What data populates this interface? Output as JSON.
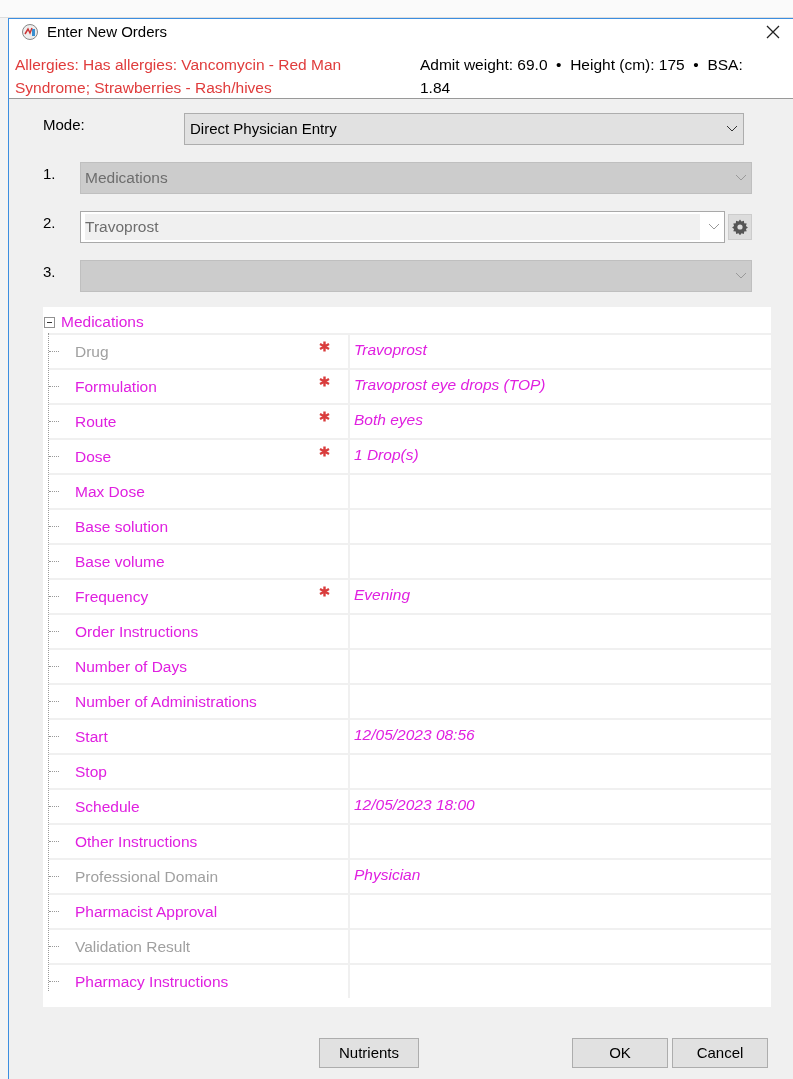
{
  "window": {
    "title": "Enter New Orders"
  },
  "allergies": "Allergies: Has allergies: Vancomycin - Red Man Syndrome; Strawberries - Rash/hives",
  "measurements": "Admit weight: 69.0  •  Height (cm): 175  •  BSA: 1.84",
  "mode": {
    "label": "Mode:",
    "value": "Direct Physician Entry"
  },
  "steps": [
    {
      "label": "1.",
      "value": "Medications",
      "disabled": true,
      "settings": false
    },
    {
      "label": "2.",
      "value": "Travoprost",
      "disabled": false,
      "settings": true
    },
    {
      "label": "3.",
      "disabled": true,
      "settings": false
    }
  ],
  "tree": {
    "title": "Medications",
    "expanded": true,
    "rows": [
      {
        "label": "Drug",
        "disabled": true,
        "required": true,
        "value": "Travoprost"
      },
      {
        "label": "Formulation",
        "disabled": false,
        "required": true,
        "value": "Travoprost eye drops (TOP)"
      },
      {
        "label": "Route",
        "disabled": false,
        "required": true,
        "value": "Both eyes"
      },
      {
        "label": "Dose",
        "disabled": false,
        "required": true,
        "value": "1 Drop(s)"
      },
      {
        "label": "Max Dose",
        "disabled": false,
        "required": false
      },
      {
        "label": "Base solution",
        "disabled": false,
        "required": false
      },
      {
        "label": "Base volume",
        "disabled": false,
        "required": false
      },
      {
        "label": "Frequency",
        "disabled": false,
        "required": true,
        "value": "Evening"
      },
      {
        "label": "Order Instructions",
        "disabled": false,
        "required": false
      },
      {
        "label": "Number of Days",
        "disabled": false,
        "required": false
      },
      {
        "label": "Number of Administrations",
        "disabled": false,
        "required": false
      },
      {
        "label": "Start",
        "disabled": false,
        "required": false,
        "value": "12/05/2023 08:56"
      },
      {
        "label": "Stop",
        "disabled": false,
        "required": false
      },
      {
        "label": "Schedule",
        "disabled": false,
        "required": false,
        "value": "12/05/2023 18:00"
      },
      {
        "label": "Other Instructions",
        "disabled": false,
        "required": false
      },
      {
        "label": "Professional Domain",
        "disabled": true,
        "required": false,
        "value": "Physician"
      },
      {
        "label": "Pharmacist Approval",
        "disabled": false,
        "required": false
      },
      {
        "label": "Validation Result",
        "disabled": true,
        "required": false
      },
      {
        "label": "Pharmacy Instructions",
        "disabled": false,
        "required": false
      }
    ]
  },
  "buttons": [
    {
      "label": "Nutrients",
      "kind": "left"
    },
    {
      "label": "OK",
      "kind": "right"
    },
    {
      "label": "Cancel",
      "kind": "right"
    }
  ]
}
